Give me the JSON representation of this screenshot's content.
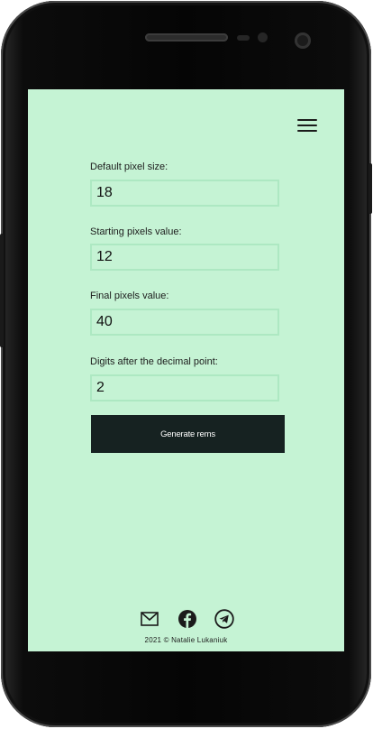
{
  "header": {
    "menu_icon": "hamburger-menu-icon"
  },
  "form": {
    "default_pixel": {
      "label": "Default pixel size:",
      "value": "18"
    },
    "starting_pixels": {
      "label": "Starting pixels value:",
      "value": "12"
    },
    "final_pixels": {
      "label": "Final pixels value:",
      "value": "40"
    },
    "digits": {
      "label": "Digits after the decimal point:",
      "value": "2"
    },
    "generate_label": "Generate rems"
  },
  "footer": {
    "icons": [
      "mail-icon",
      "facebook-icon",
      "telegram-icon"
    ],
    "copyright": "2021 © Natalie Lukaniuk"
  },
  "colors": {
    "screen_bg": "#c5f3d4",
    "input_border": "#ade8c2",
    "button_bg": "#162221",
    "button_text": "#ffffff"
  }
}
